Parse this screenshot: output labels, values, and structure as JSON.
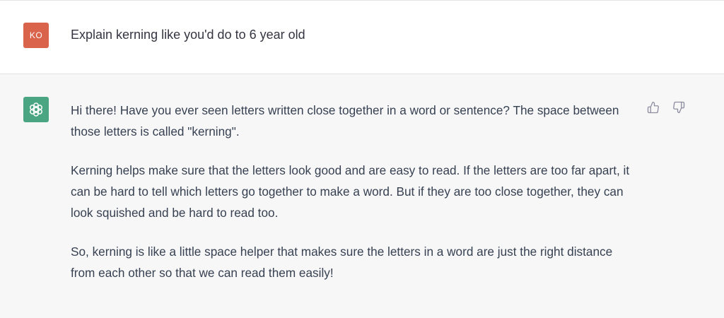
{
  "user_message": {
    "avatar_initials": "KO",
    "text": "Explain kerning like you'd do to 6 year old"
  },
  "assistant_message": {
    "avatar_icon": "openai-logo-icon",
    "paragraphs": [
      "Hi there! Have you ever seen letters written close together in a word or sentence? The space between those letters is called \"kerning\".",
      "Kerning helps make sure that the letters look good and are easy to read. If the letters are too far apart, it can be hard to tell which letters go together to make a word. But if they are too close together, they can look squished and be hard to read too.",
      "So, kerning is like a little space helper that makes sure the letters in a word are just the right distance from each other so that we can read them easily!"
    ],
    "actions": [
      "thumbs-up-icon",
      "thumbs-down-icon"
    ]
  },
  "colors": {
    "user_avatar": "#d9634b",
    "assistant_avatar": "#4aa582",
    "assistant_bg": "#f7f7f8",
    "text": "#374151"
  }
}
